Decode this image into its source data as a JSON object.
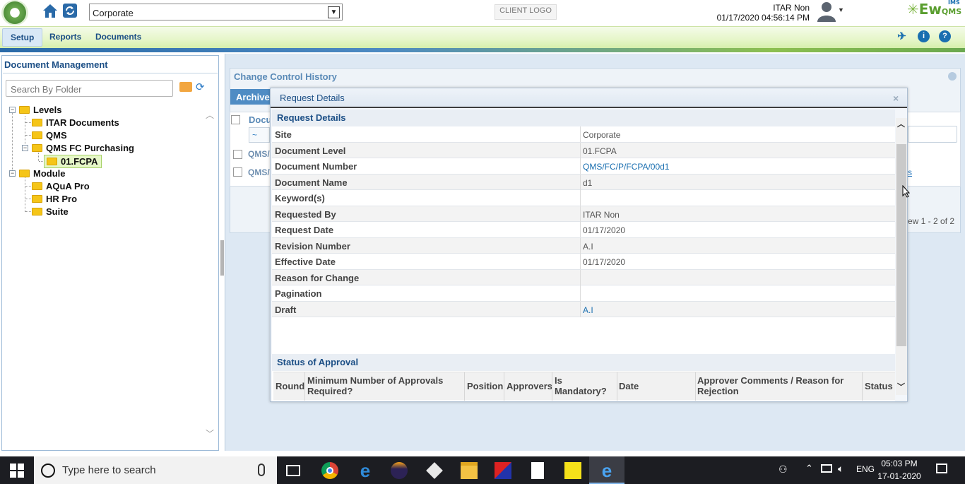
{
  "header": {
    "site_selected": "Corporate",
    "client_logo": "CLIENT LOGO",
    "user_name": "ITAR Non",
    "datetime": "01/17/2020 04:56:14 PM",
    "brand": "Ew",
    "brand_sub": "IMS",
    "brand_qms": "QMS"
  },
  "menu": {
    "items": [
      {
        "label": "Setup"
      },
      {
        "label": "Reports"
      },
      {
        "label": "Documents"
      }
    ],
    "icons": [
      "pin-icon",
      "info-icon",
      "help-icon"
    ]
  },
  "left_panel": {
    "title": "Document Management",
    "search_placeholder": "Search By Folder",
    "tree": [
      {
        "label": "Levels"
      },
      {
        "label": "ITAR Documents"
      },
      {
        "label": "QMS"
      },
      {
        "label": "QMS FC Purchasing"
      },
      {
        "label": "01.FCPA"
      },
      {
        "label": "Module"
      },
      {
        "label": "AQuA Pro"
      },
      {
        "label": "HR Pro"
      },
      {
        "label": "Suite"
      }
    ]
  },
  "background": {
    "section_title": "Change Control History",
    "archive_tab": "Archive",
    "col_doc": "Docu",
    "filter": "~",
    "row1": "QMS/",
    "row2": "QMS/",
    "link": "s",
    "view_count": "ew 1 - 2 of 2"
  },
  "modal": {
    "title": "Request Details",
    "section_title": "Request Details",
    "rows": [
      {
        "label": "Site",
        "value": "Corporate",
        "link": false
      },
      {
        "label": "Document Level",
        "value": "01.FCPA",
        "link": false
      },
      {
        "label": "Document Number",
        "value": "QMS/FC/P/FCPA/00d1",
        "link": true
      },
      {
        "label": "Document Name",
        "value": "d1",
        "link": false
      },
      {
        "label": "Keyword(s)",
        "value": "",
        "link": false
      },
      {
        "label": "Requested By",
        "value": "ITAR Non",
        "link": false
      },
      {
        "label": "Request Date",
        "value": "01/17/2020",
        "link": false
      },
      {
        "label": "Revision Number",
        "value": "A.I",
        "link": false
      },
      {
        "label": "Effective Date",
        "value": "01/17/2020",
        "link": false
      },
      {
        "label": "Reason for Change",
        "value": "",
        "link": false
      },
      {
        "label": "Pagination",
        "value": "",
        "link": false
      },
      {
        "label": "Draft",
        "value": "A.I",
        "link": true
      }
    ],
    "approval_title": "Status of Approval",
    "approval_columns": [
      "Round",
      "Minimum Number of Approvals Required?",
      "Position",
      "Approvers",
      "Is Mandatory?",
      "Date",
      "Approver Comments / Reason for Rejection",
      "Status"
    ]
  },
  "taskbar": {
    "search_placeholder": "Type here to search",
    "language": "ENG",
    "time": "05:03 PM",
    "date": "17-01-2020"
  },
  "colors": {
    "accent_blue": "#1c4f86",
    "menu_green": "#e6f6c9",
    "link_blue": "#1a6fb0"
  }
}
